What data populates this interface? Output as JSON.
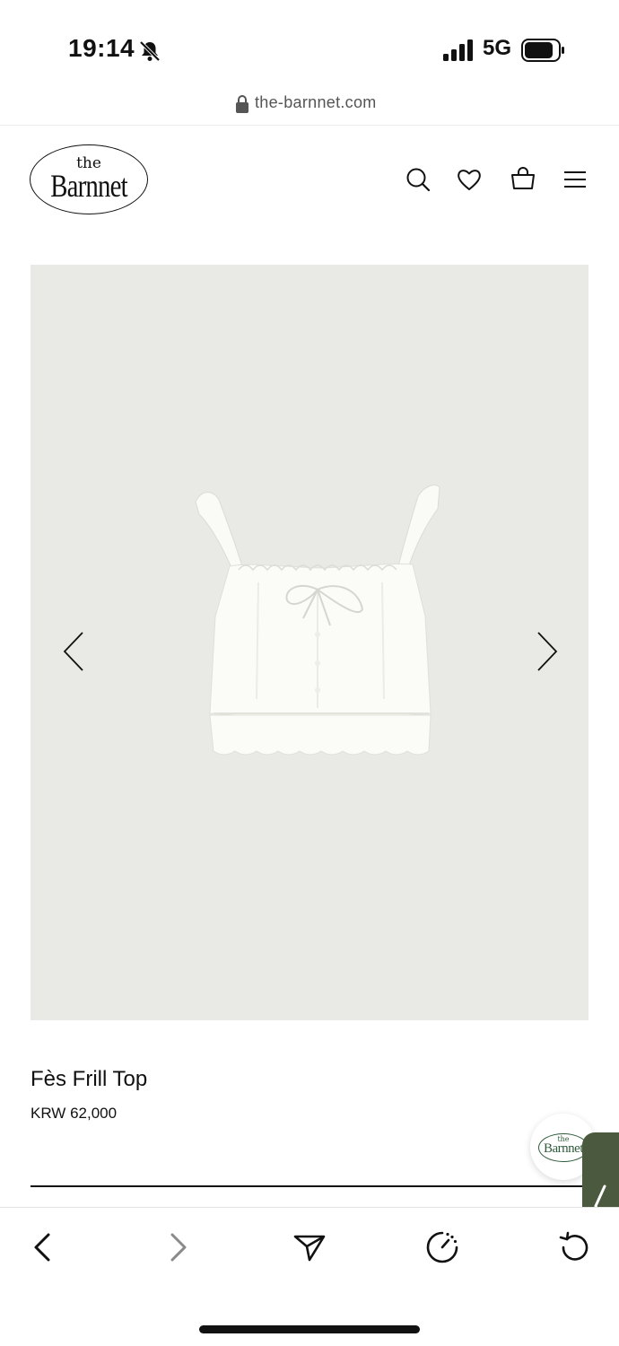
{
  "status_bar": {
    "time": "19:14",
    "network": "5G",
    "icons": [
      "bell-slash-icon",
      "signal-icon",
      "battery-icon"
    ]
  },
  "browser": {
    "url": "the-barnnet.com",
    "toolbar_icons": [
      "back-icon",
      "forward-icon",
      "share-icon",
      "speed-icon",
      "reload-icon"
    ]
  },
  "header": {
    "logo_small": "the",
    "logo_main": "Barnnet",
    "icons": [
      "search-icon",
      "heart-icon",
      "bag-icon",
      "menu-icon"
    ]
  },
  "product": {
    "name": "Fès Frill Top",
    "price": "KRW 62,000",
    "image_background": "#e9e9e5"
  },
  "chat": {
    "logo_small": "the",
    "logo_main": "Barnnet"
  },
  "colors": {
    "side_tab": "#4b5a3e",
    "text": "#111111"
  }
}
